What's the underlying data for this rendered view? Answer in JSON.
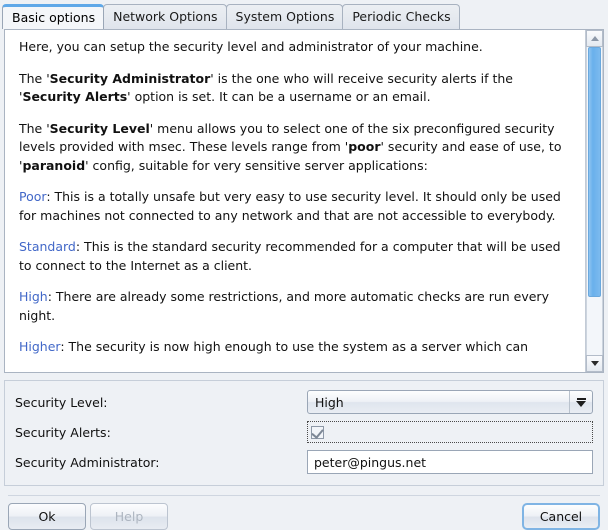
{
  "tabs": [
    {
      "label": "Basic options",
      "active": true
    },
    {
      "label": "Network Options",
      "active": false
    },
    {
      "label": "System Options",
      "active": false
    },
    {
      "label": "Periodic Checks",
      "active": false
    }
  ],
  "content": {
    "p1": "Here, you can setup the security level and administrator of your machine.",
    "p2_a": "The '",
    "p2_b": "Security Administrator",
    "p2_c": "' is the one who will receive security alerts if the '",
    "p2_d": "Security Alerts",
    "p2_e": "' option is set. It can be a username or an email.",
    "p3_a": "The '",
    "p3_b": "Security Level",
    "p3_c": "' menu allows you to select one of the six preconfigured security levels provided with msec. These levels range from '",
    "p3_d": "poor",
    "p3_e": "' security and ease of use, to '",
    "p3_f": "paranoid",
    "p3_g": "' config, suitable for very sensitive server applications:",
    "lvl1_name": "Poor",
    "lvl1_text": ": This is a totally unsafe but very easy to use security level. It should only be used for machines not connected to any network and that are not accessible to everybody.",
    "lvl2_name": "Standard",
    "lvl2_text": ": This is the standard security recommended for a computer that will be used to connect to the Internet as a client.",
    "lvl3_name": "High",
    "lvl3_text": ": There are already some restrictions, and more automatic checks are run every night.",
    "lvl4_name": "Higher",
    "lvl4_text": ": The security is now high enough to use the system as a server which can"
  },
  "form": {
    "security_level_label": "Security Level:",
    "security_level_value": "High",
    "security_alerts_label": "Security Alerts:",
    "security_alerts_checked": true,
    "security_admin_label": "Security Administrator:",
    "security_admin_value": "peter@pingus.net"
  },
  "footer": {
    "ok_label": "Ok",
    "help_label": "Help",
    "cancel_label": "Cancel"
  },
  "colors": {
    "level_link": "#4268c8",
    "active_tab_accent": "#5fa8e8",
    "scrollbar_thumb": "#69b0ec",
    "focus_ring": "#7fb4e4",
    "window_bg": "#eef1f5"
  }
}
